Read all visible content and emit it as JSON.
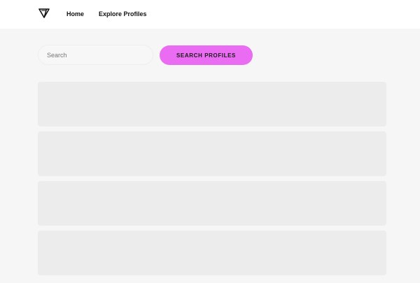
{
  "nav": {
    "logo_icon": "v-triangle-logo-icon",
    "links": [
      {
        "label": "Home"
      },
      {
        "label": "Explore Profiles"
      }
    ]
  },
  "search": {
    "placeholder": "Search",
    "value": "",
    "button_label": "SEARCH PROFILES"
  },
  "colors": {
    "page_background": "#f6f6f6",
    "navbar_background": "#ffffff",
    "accent": "#e96cf2",
    "card_placeholder": "#ececec"
  },
  "results": {
    "state": "loading",
    "card_count": 4
  }
}
